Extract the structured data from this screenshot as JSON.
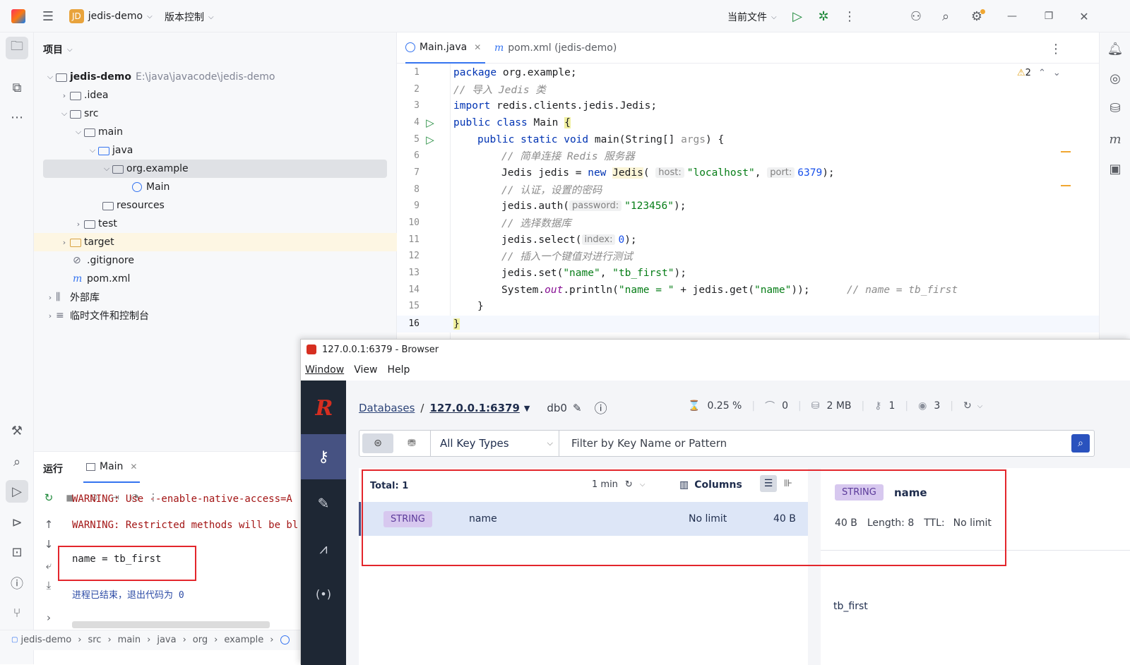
{
  "titlebar": {
    "project_initials": "JD",
    "project_name": "jedis-demo",
    "vcs": "版本控制",
    "run_config": "当前文件"
  },
  "project_panel": {
    "title": "项目",
    "tree": [
      {
        "label": "jedis-demo",
        "path": "E:\\java\\javacode\\jedis-demo"
      },
      {
        "label": ".idea"
      },
      {
        "label": "src"
      },
      {
        "label": "main"
      },
      {
        "label": "java"
      },
      {
        "label": "org.example"
      },
      {
        "label": "Main"
      },
      {
        "label": "resources"
      },
      {
        "label": "test"
      },
      {
        "label": "target"
      },
      {
        "label": ".gitignore"
      },
      {
        "label": "pom.xml"
      },
      {
        "label": "外部库"
      },
      {
        "label": "临时文件和控制台"
      }
    ]
  },
  "editor": {
    "tabs": [
      {
        "label": "Main.java"
      },
      {
        "label": "pom.xml (jedis-demo)"
      }
    ],
    "warnings": "2",
    "lines": [
      "1",
      "2",
      "3",
      "4",
      "5",
      "6",
      "7",
      "8",
      "9",
      "10",
      "11",
      "12",
      "13",
      "14",
      "15",
      "16"
    ],
    "code": {
      "l1a": "package",
      "l1b": " org.example;",
      "l2": "// 导入 Jedis 类",
      "l3a": "import",
      "l3b": " redis.clients.jedis.Jedis;",
      "l4a": "public class",
      "l4b": " Main ",
      "l4c": "{",
      "l5a": "public static void",
      "l5b": " main(String[] ",
      "l5c": "args",
      "l5d": ") {",
      "l6": "// 简单连接 Redis 服务器",
      "l7a": "Jedis jedis = ",
      "l7b": "new",
      "l7c": "Jedis",
      "l7d": "(",
      "l7h1": "host:",
      "l7s1": "\"localhost\"",
      "l7e": ", ",
      "l7h2": "port:",
      "l7n": "6379",
      "l7f": ");",
      "l8": "// 认证，设置的密码",
      "l9a": "jedis.auth(",
      "l9h": "password:",
      "l9s": "\"123456\"",
      "l9b": ");",
      "l10": "// 选择数据库",
      "l11a": "jedis.select(",
      "l11h": "index:",
      "l11n": "0",
      "l11b": ");",
      "l12": "// 插入一个键值对进行测试",
      "l13a": "jedis.set(",
      "l13s1": "\"name\"",
      "l13b": ", ",
      "l13s2": "\"tb_first\"",
      "l13c": ");",
      "l14a": "System.",
      "l14b": "out",
      "l14c": ".println(",
      "l14s1": "\"name = \"",
      "l14d": " + jedis.get(",
      "l14s2": "\"name\"",
      "l14e": "));",
      "l14cm": "// name = tb_first",
      "l15": "}",
      "l16": "}"
    }
  },
  "run_panel": {
    "title": "运行",
    "tab": "Main",
    "out1": "WARNING: Use --enable-native-access=A",
    "out2": "WARNING: Restricted methods will be bl",
    "out3": "name = tb_first",
    "out4": "进程已结束，退出代码为 0"
  },
  "status_bar": {
    "crumbs": [
      "jedis-demo",
      "src",
      "main",
      "java",
      "org",
      "example"
    ]
  },
  "redis": {
    "window_title": "127.0.0.1:6379 - Browser",
    "menu": [
      "Window",
      "View",
      "Help"
    ],
    "breadcrumb_db": "Databases",
    "breadcrumb_host": "127.0.0.1:6379",
    "db": "db0",
    "stats": {
      "cpu": "0.25 %",
      "ops": "0",
      "memory": "2 MB",
      "keys": "1",
      "clients": "3"
    },
    "filter": {
      "key_type": "All Key Types",
      "placeholder": "Filter by Key Name or Pattern"
    },
    "list": {
      "total": "Total: 1",
      "refresh": "1 min",
      "columns": "Columns"
    },
    "row": {
      "type": "STRING",
      "name": "name",
      "ttl": "No limit",
      "size": "40 B"
    },
    "detail": {
      "type": "STRING",
      "name": "name",
      "size": "40 B",
      "length": "Length: 8",
      "ttl_label": "TTL:",
      "ttl": "No limit",
      "value": "tb_first"
    }
  },
  "colors": {
    "accent": "#3574f0",
    "redis_dark": "#1e2734",
    "redis_red": "#d62e20",
    "highlight_box": "#e3262c"
  }
}
